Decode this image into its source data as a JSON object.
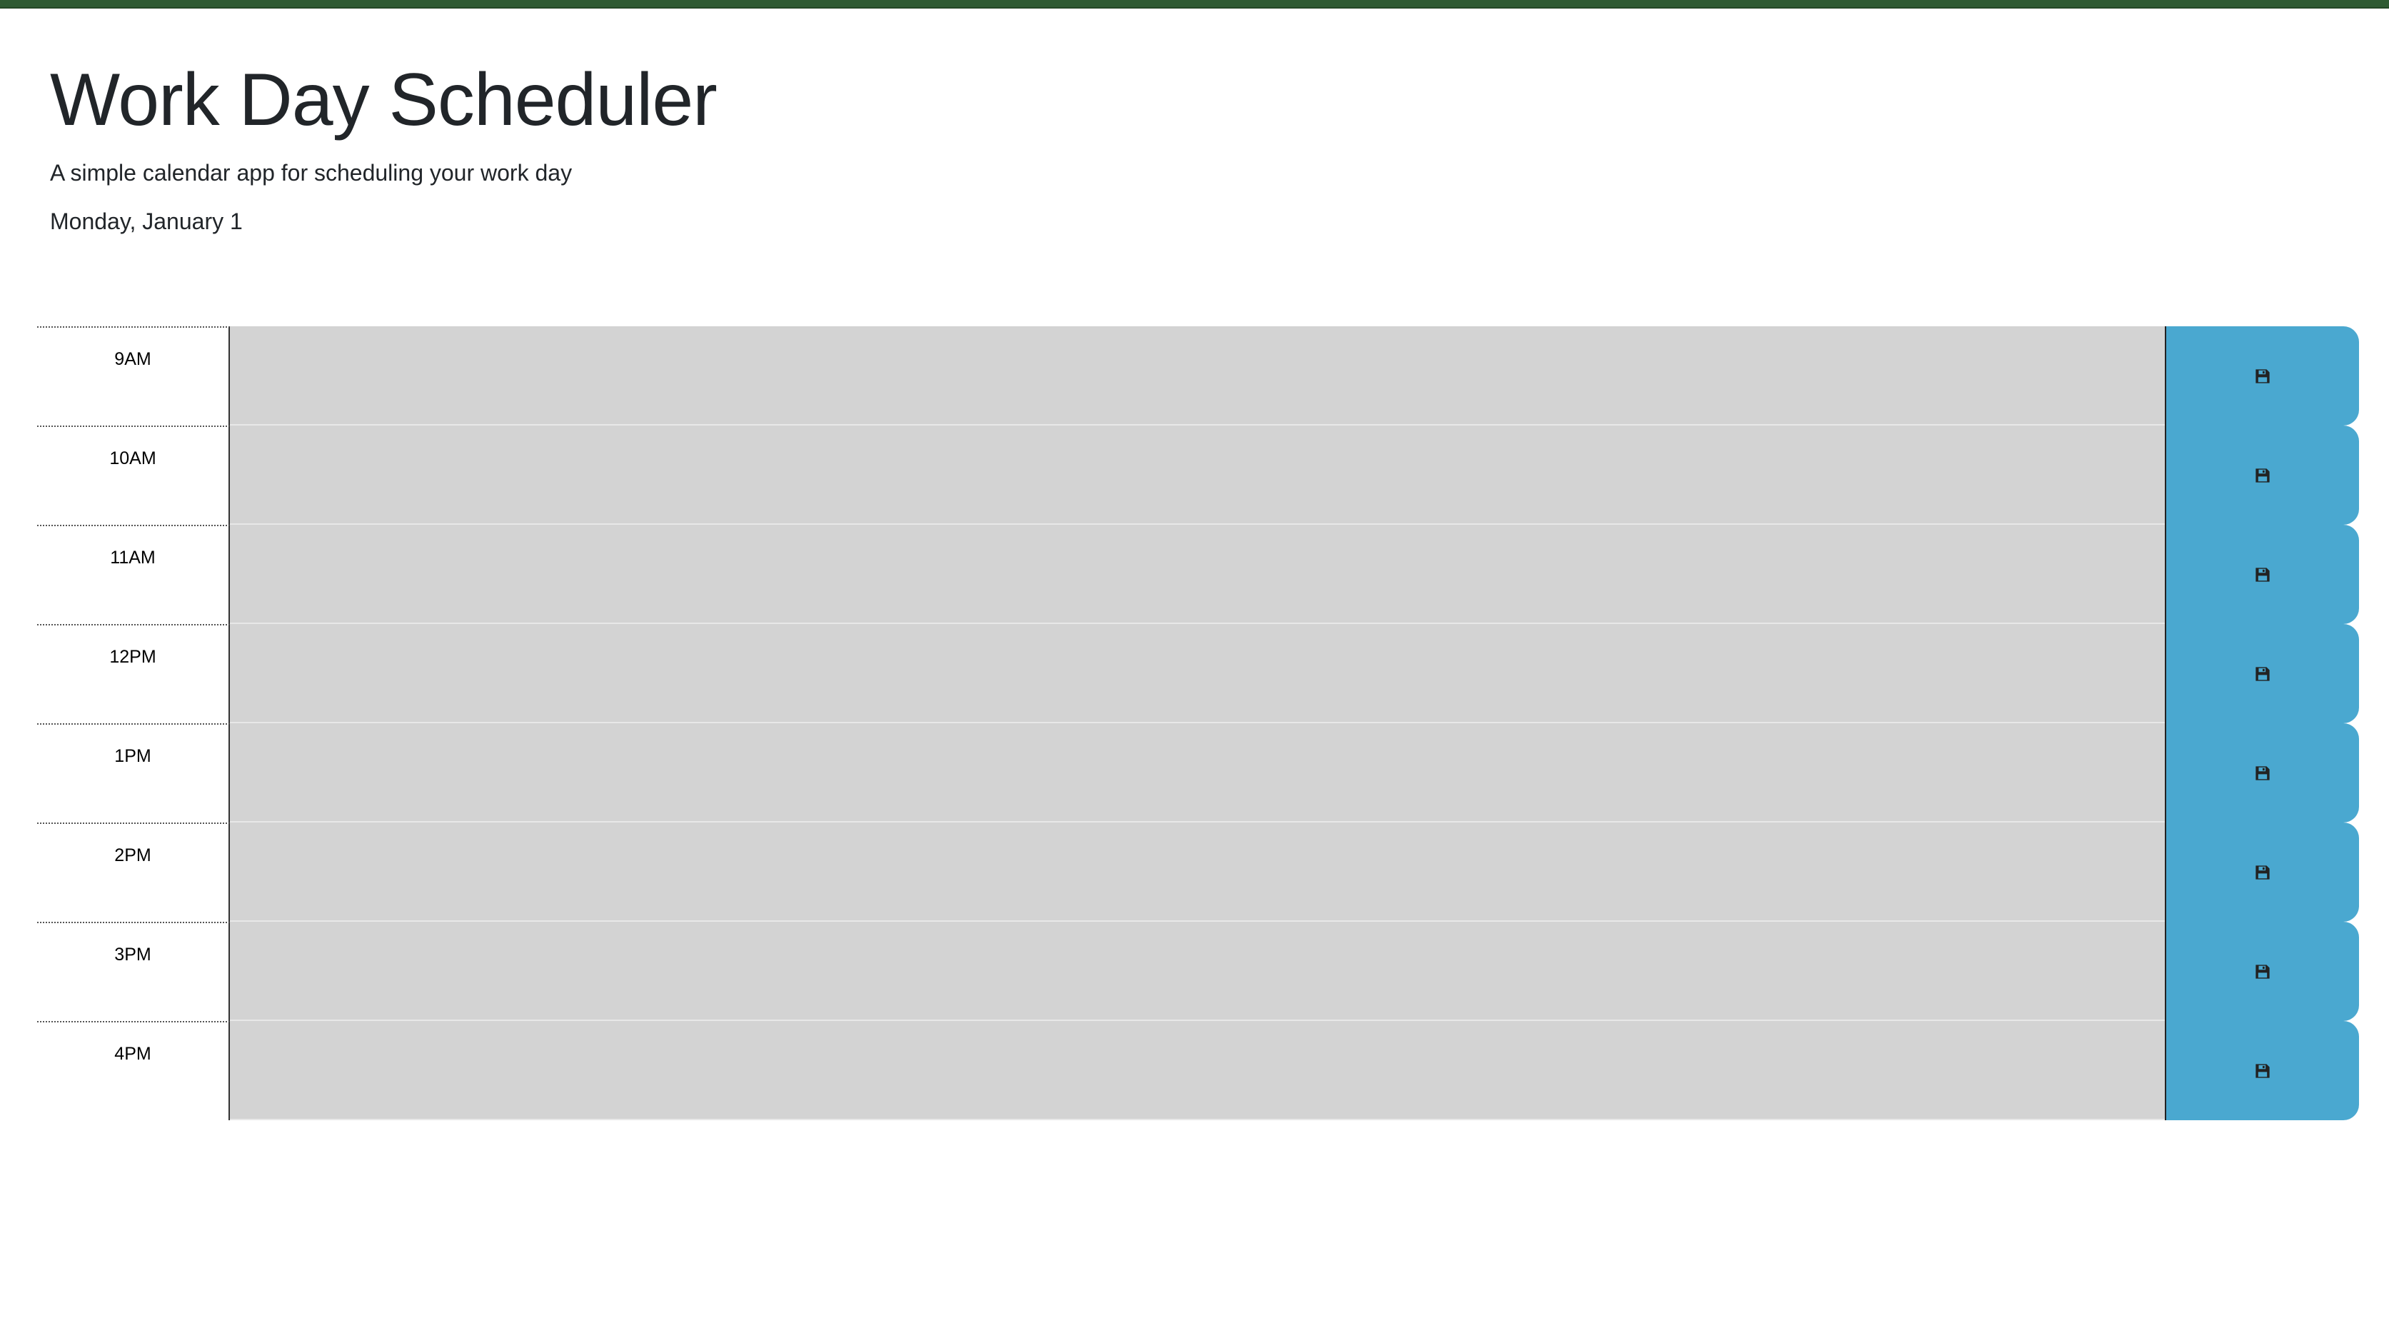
{
  "colors": {
    "top_bar": "#2e5a32",
    "row_background": "#d3d3d3",
    "save_button": "#4aa8d0"
  },
  "header": {
    "title": "Work Day Scheduler",
    "subtitle": "A simple calendar app for scheduling your work day",
    "current_day": "Monday, January 1"
  },
  "schedule": {
    "rows": [
      {
        "hour": "9AM",
        "text": ""
      },
      {
        "hour": "10AM",
        "text": ""
      },
      {
        "hour": "11AM",
        "text": ""
      },
      {
        "hour": "12PM",
        "text": ""
      },
      {
        "hour": "1PM",
        "text": ""
      },
      {
        "hour": "2PM",
        "text": ""
      },
      {
        "hour": "3PM",
        "text": ""
      },
      {
        "hour": "4PM",
        "text": ""
      }
    ],
    "save_icon": "floppy-disk-icon"
  }
}
